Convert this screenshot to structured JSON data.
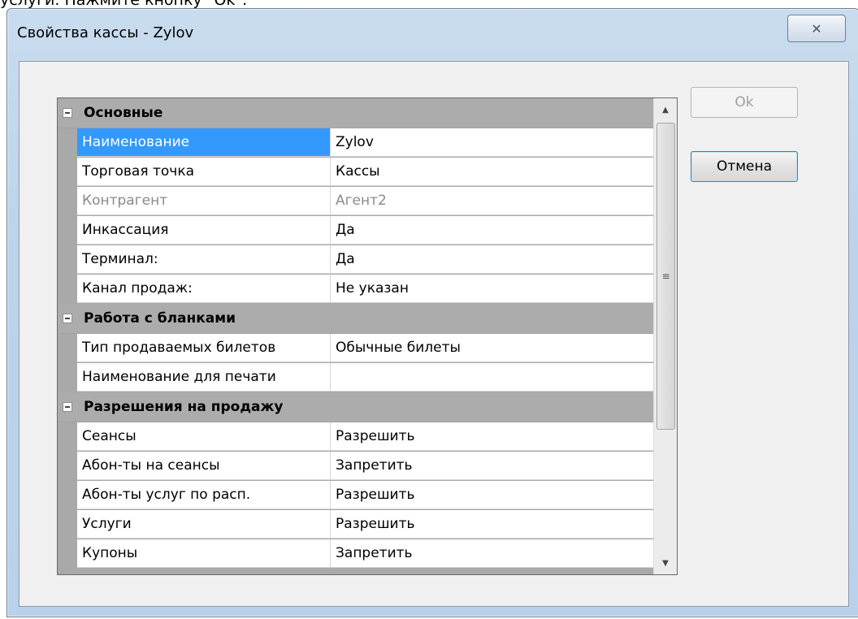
{
  "top_crop_text": "услуги. Нажмите кнопку \"Ok\".",
  "window": {
    "title": "Свойства кассы - Zylov",
    "close_glyph": "✕"
  },
  "buttons": {
    "ok": "Ok",
    "cancel": "Отмена"
  },
  "property_grid": {
    "categories": [
      {
        "label": "Основные",
        "properties": [
          {
            "name": "Наименование",
            "value": "Zylov",
            "selected": true
          },
          {
            "name": "Торговая точка",
            "value": "Кассы"
          },
          {
            "name": "Контрагент",
            "value": "Агент2",
            "disabled": true
          },
          {
            "name": "Инкассация",
            "value": "Да"
          },
          {
            "name": "Терминал:",
            "value": "Да"
          },
          {
            "name": "Канал продаж:",
            "value": "Не указан"
          }
        ]
      },
      {
        "label": "Работа с бланками",
        "properties": [
          {
            "name": "Тип продаваемых билетов",
            "value": "Обычные билеты"
          },
          {
            "name": "Наименование для печати",
            "value": ""
          }
        ]
      },
      {
        "label": "Разрешения на продажу",
        "properties": [
          {
            "name": "Сеансы",
            "value": "Разрешить"
          },
          {
            "name": "Абон-ты на сеансы",
            "value": "Запретить"
          },
          {
            "name": "Абон-ты услуг по расп.",
            "value": "Разрешить"
          },
          {
            "name": "Услуги",
            "value": "Разрешить"
          },
          {
            "name": "Купоны",
            "value": "Запретить"
          }
        ]
      }
    ],
    "scrollbar": {
      "up": "▲",
      "down": "▼",
      "grip": "≡"
    }
  }
}
